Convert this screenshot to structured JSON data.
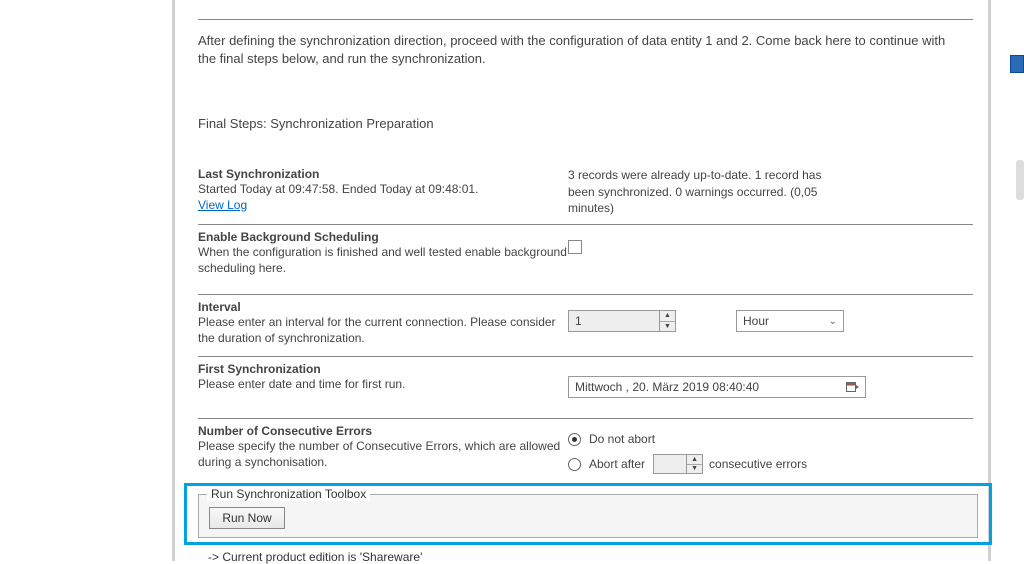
{
  "intro": "After defining the synchronization direction, proceed with the configuration of data entity 1 and 2. Come back here to continue with the final steps below, and run the synchronization.",
  "final_steps_title": "Final Steps: Synchronization Preparation",
  "last_sync": {
    "title": "Last Synchronization",
    "desc": "Started  Today at 09:47:58. Ended Today at 09:48:01.",
    "view_log": "View Log",
    "status": "3 records were already up-to-date. 1 record has been synchronized. 0 warnings occurred.  (0,05 minutes)"
  },
  "bg_schedule": {
    "title": "Enable Background Scheduling",
    "desc": "When the configuration is finished and well tested enable background scheduling here."
  },
  "interval": {
    "title": "Interval",
    "desc": "Please enter an interval for the current connection. Please consider the duration of synchronization.",
    "value": "1",
    "unit": "Hour"
  },
  "first_sync": {
    "title": "First Synchronization",
    "desc": "Please enter date and time for first run.",
    "value": "Mittwoch , 20.     März     2019 08:40:40"
  },
  "errors": {
    "title": "Number of Consecutive Errors",
    "desc": "Please specify the number of Consecutive Errors, which are allowed during a synchonisation.",
    "option_no_abort": "Do not abort",
    "option_abort_prefix": "Abort after",
    "option_abort_suffix": "consecutive errors",
    "abort_value": ""
  },
  "toolbox": {
    "legend": "Run Synchronization Toolbox",
    "run_now": "Run Now"
  },
  "log_line": "-> Current product edition is 'Shareware'"
}
